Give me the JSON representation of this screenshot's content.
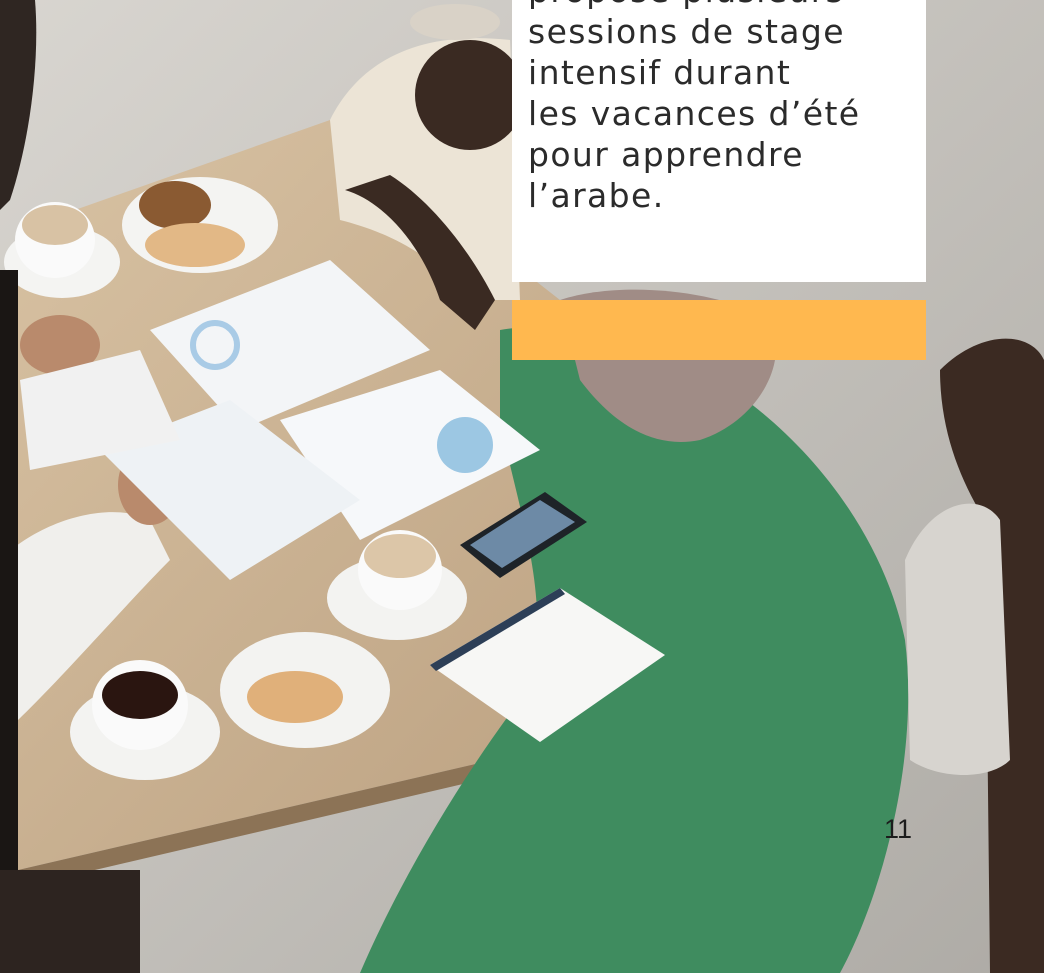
{
  "page": {
    "body_text": "propose plusieurs\nsessions de stage\nintensif durant\nles vacances d’été\npour apprendre\nl’arabe.",
    "page_number": "11"
  },
  "colors": {
    "accent_bar": "#ffb84f",
    "card_background": "#ffffff",
    "text": "#2b2b2b"
  },
  "photo": {
    "subject": "meeting-table-photo"
  }
}
